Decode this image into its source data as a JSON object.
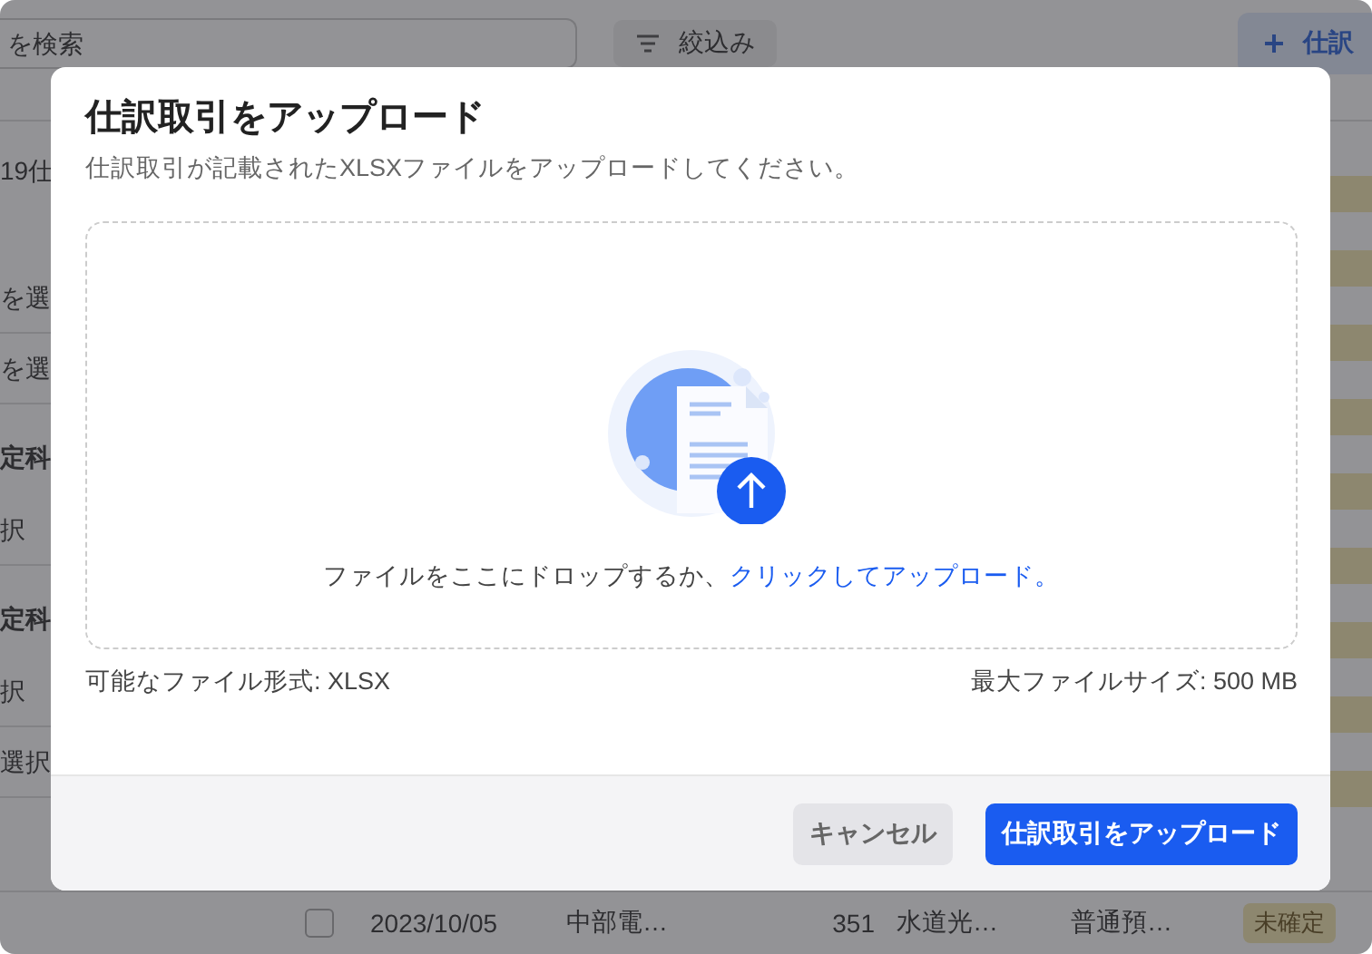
{
  "background": {
    "search": {
      "placeholder": "を検索"
    },
    "filter_button": "絞込み",
    "add_button": "仕訳",
    "sidebar": [
      {
        "kind": "count",
        "text": "19仕"
      },
      {
        "kind": "option",
        "text": "を選"
      },
      {
        "kind": "option",
        "text": "を選"
      },
      {
        "kind": "heading",
        "text": "定科"
      },
      {
        "kind": "option",
        "text": "択"
      },
      {
        "kind": "heading",
        "text": "定科"
      },
      {
        "kind": "option",
        "text": "択"
      },
      {
        "kind": "option",
        "text": "選択"
      }
    ],
    "table_row": {
      "checked": false,
      "date": "2023/10/05",
      "partner": "中部電…",
      "amount": "351",
      "account": "水道光…",
      "payment": "普通預…",
      "status": "未確定"
    }
  },
  "dialog": {
    "title": "仕訳取引をアップロード",
    "subtitle": "仕訳取引が記載されたXLSXファイルをアップロードしてください。",
    "dropzone": {
      "text": "ファイルをここにドロップするか、",
      "link": "クリックしてアップロード。"
    },
    "formats": "可能なファイル形式: XLSX",
    "max_size": "最大ファイルサイズ: 500 MB",
    "buttons": [
      {
        "kind": "secondary",
        "label": "キャンセル"
      },
      {
        "kind": "primary",
        "label": "仕訳取引をアップロード"
      }
    ]
  }
}
